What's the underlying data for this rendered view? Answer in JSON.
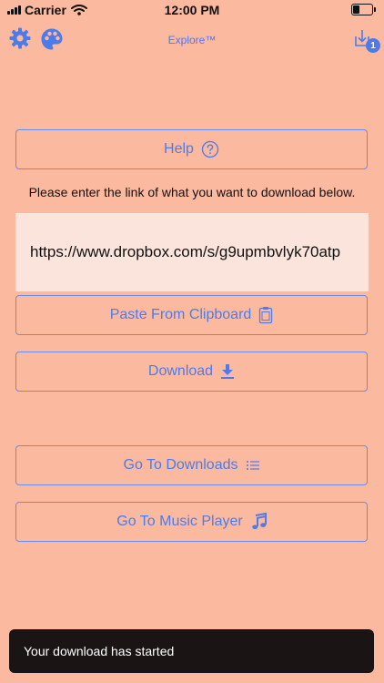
{
  "status_bar": {
    "carrier": "Carrier",
    "time": "12:00 PM",
    "battery_level": 0.4
  },
  "nav": {
    "title": "Explore™",
    "download_badge": "1"
  },
  "main": {
    "help_label": "Help",
    "instruction": "Please enter the link of what you want to download below.",
    "url_value": "https://www.dropbox.com/s/g9upmbvlyk70atp",
    "paste_label": "Paste From Clipboard",
    "download_label": "Download",
    "go_downloads_label": "Go To Downloads",
    "music_player_label": "Go To Music Player"
  },
  "toast": {
    "message": "Your download has started"
  },
  "colors": {
    "background": "#FBB9A0",
    "accent": "#4F7BE8",
    "field": "#FBE4DB",
    "toast": "#1B1414"
  },
  "icons": [
    "gear-icon",
    "palette-icon",
    "download-tray-icon",
    "help-circle-icon",
    "clipboard-icon",
    "download-arrow-icon",
    "list-icon",
    "music-note-icon",
    "wifi-icon",
    "signal-icon",
    "battery-icon"
  ]
}
